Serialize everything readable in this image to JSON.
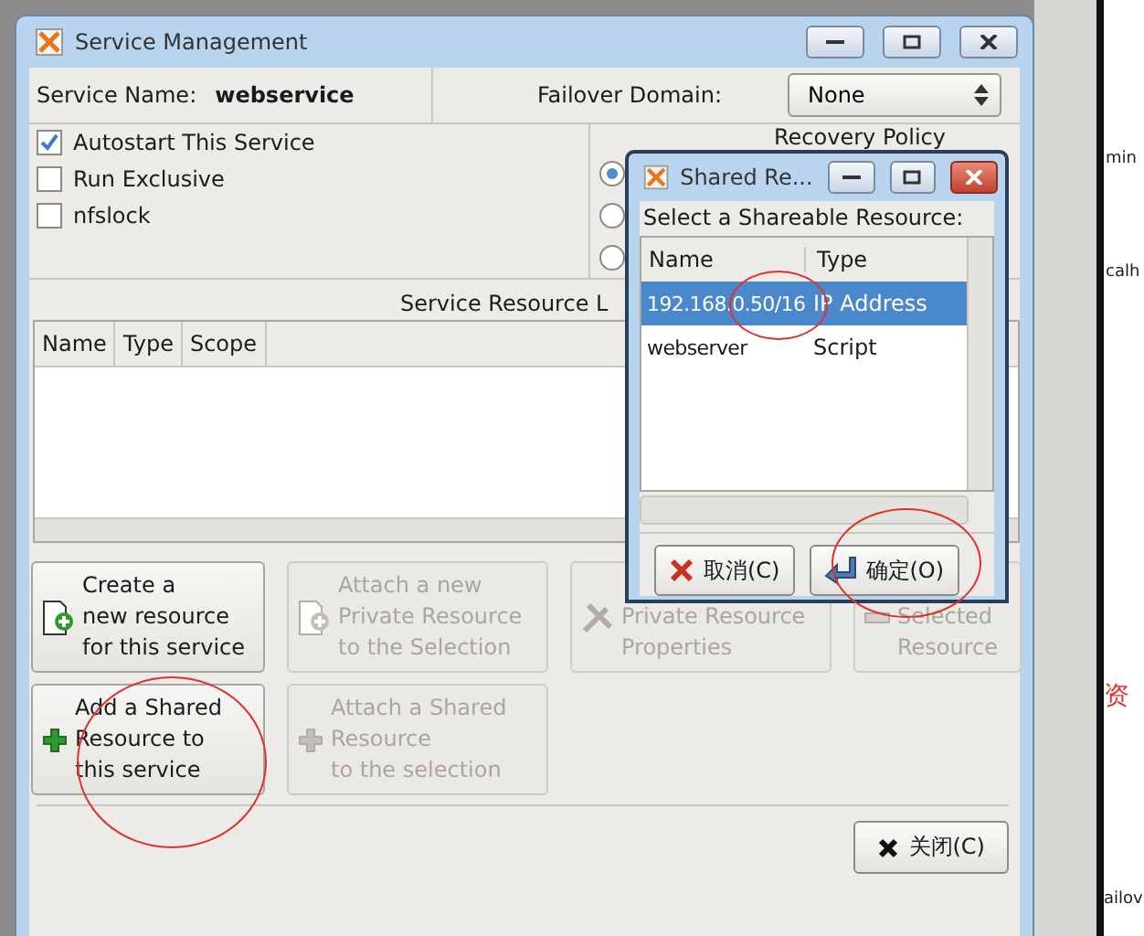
{
  "background": {
    "texts": [
      "min",
      "calh",
      "资",
      "ailov"
    ]
  },
  "main_window": {
    "title": "Service Management",
    "service_name_label": "Service Name:",
    "service_name": "webservice",
    "failover_label": "Failover Domain:",
    "failover_value": "None",
    "options": [
      {
        "label": "Autostart This Service",
        "checked": true
      },
      {
        "label": "Run Exclusive",
        "checked": false
      },
      {
        "label": "nfslock",
        "checked": false
      }
    ],
    "recovery_policy": {
      "title": "Recovery Policy",
      "radios": [
        {
          "selected": true
        },
        {
          "selected": false
        },
        {
          "selected": false
        }
      ]
    },
    "resource_list": {
      "title": "Service Resource L",
      "columns": [
        "Name",
        "Type",
        "Scope"
      ]
    },
    "actions": [
      {
        "label": "Create a\nnew resource\nfor this service",
        "disabled": false
      },
      {
        "label": "Attach a new\nPrivate Resource\nto the Selection",
        "disabled": true
      },
      {
        "label": "Private Resource\nProperties",
        "disabled": true
      },
      {
        "label": "Selected\nResource",
        "disabled": true
      },
      {
        "label": "Add a Shared\nResource to\nthis service",
        "disabled": false
      },
      {
        "label": "Attach a Shared\nResource\nto the selection",
        "disabled": true
      }
    ],
    "close_button": "关闭(C)"
  },
  "dialog": {
    "title": "Shared Re...",
    "prompt": "Select a Shareable Resource:",
    "columns": [
      "Name",
      "Type"
    ],
    "rows": [
      {
        "name": "192.168.0.50/16",
        "type": "IP Address",
        "selected": true
      },
      {
        "name": "webserver",
        "type": "Script",
        "selected": false
      }
    ],
    "cancel_button": "取消(C)",
    "ok_button": "确定(O)"
  }
}
